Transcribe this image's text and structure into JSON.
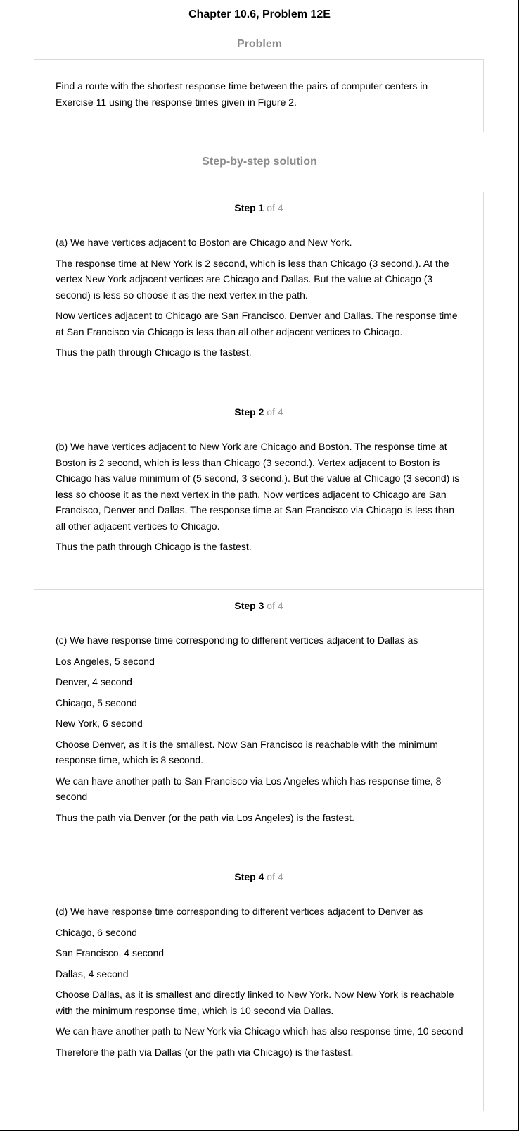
{
  "title": "Chapter 10.6, Problem 12E",
  "problem": {
    "label": "Problem",
    "text": "Find a route with the shortest response time between the pairs of computer centers in Exercise 11 using the response times given in Figure 2."
  },
  "solution": {
    "label": "Step-by-step solution",
    "steps": [
      {
        "label": "Step 1",
        "of": "of 4",
        "paragraphs": [
          "(a) We have vertices adjacent to Boston are Chicago and New York.",
          "The response time at New York is 2 second, which is less than Chicago (3 second.). At the vertex New York adjacent vertices are Chicago and Dallas. But the value at Chicago (3 second) is less so choose it as the next vertex in the path.",
          "Now vertices adjacent to Chicago are San Francisco, Denver and Dallas. The response time at San Francisco via Chicago is less than all other adjacent vertices to Chicago.",
          "Thus the path through Chicago is the fastest."
        ]
      },
      {
        "label": "Step 2",
        "of": "of 4",
        "paragraphs": [
          "(b) We have vertices adjacent to New York are Chicago and Boston. The response time at Boston is 2 second, which is less than Chicago (3 second.). Vertex adjacent to Boston is Chicago has value minimum of (5 second, 3 second.). But the value at Chicago (3 second) is less so choose it as the next vertex in the path. Now vertices adjacent to Chicago are San Francisco, Denver and Dallas. The response time at San Francisco via Chicago is less than all other adjacent vertices to Chicago.",
          "Thus the path through Chicago is the fastest."
        ]
      },
      {
        "label": "Step 3",
        "of": "of 4",
        "paragraphs": [
          "(c) We have response time corresponding to different vertices adjacent to Dallas as",
          "Los Angeles, 5 second",
          "Denver, 4 second",
          "Chicago, 5 second",
          "New York, 6 second",
          "Choose Denver, as it is the smallest. Now San Francisco is reachable with the minimum response time, which is 8 second.",
          "We can have another path to San Francisco via Los Angeles which has response time, 8 second",
          "Thus the path via Denver (or the path via Los Angeles) is the fastest."
        ]
      },
      {
        "label": "Step 4",
        "of": "of 4",
        "paragraphs": [
          "(d) We have response time corresponding to different vertices adjacent to Denver as",
          "Chicago, 6 second",
          "San Francisco, 4 second",
          "Dallas, 4 second",
          "Choose Dallas, as it is smallest and directly linked to New York. Now New York is reachable with the minimum response time, which is 10 second via Dallas.",
          "We can have another path to New York via Chicago which has also response time, 10 second",
          "Therefore the path via Dallas (or the path via Chicago) is the fastest."
        ]
      }
    ]
  }
}
